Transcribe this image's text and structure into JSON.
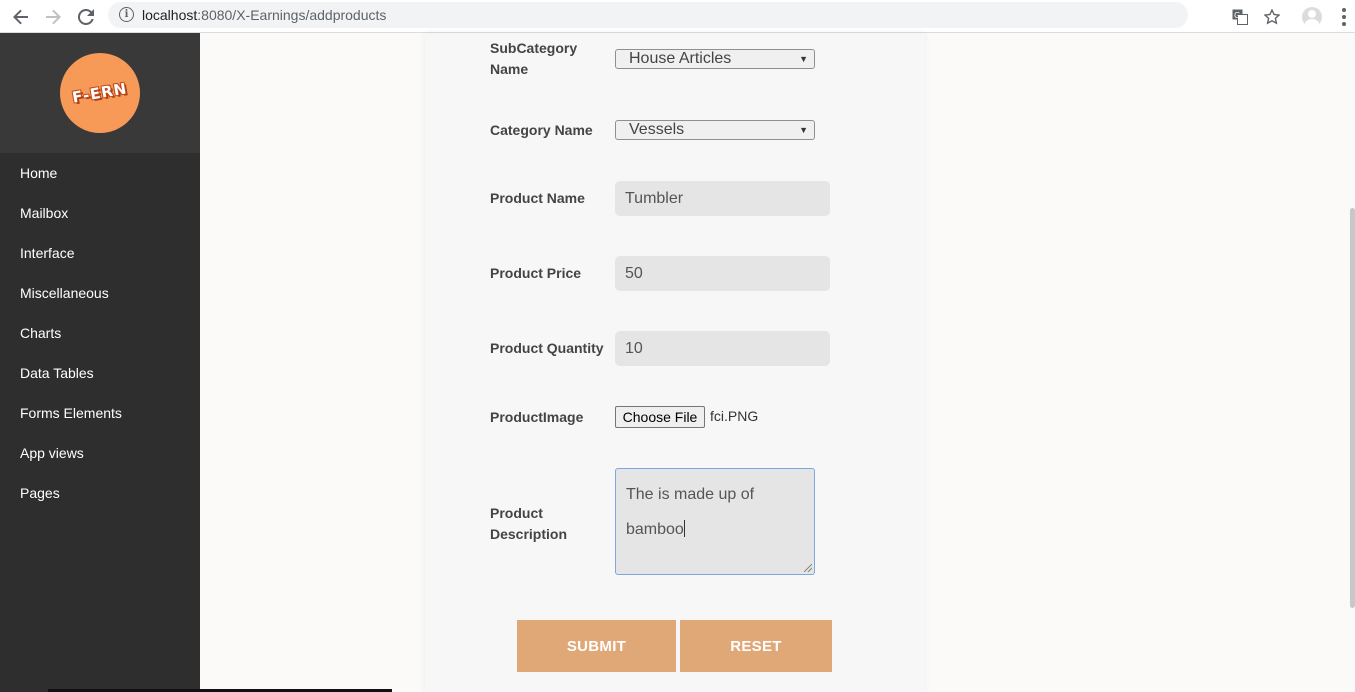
{
  "browser": {
    "url_host": "localhost",
    "url_rest": ":8080/X-Earnings/addproducts"
  },
  "sidebar": {
    "logo_text": "F-ERN",
    "items": [
      {
        "label": "Home"
      },
      {
        "label": "Mailbox"
      },
      {
        "label": "Interface"
      },
      {
        "label": "Miscellaneous"
      },
      {
        "label": "Charts"
      },
      {
        "label": "Data Tables"
      },
      {
        "label": "Forms Elements"
      },
      {
        "label": "App views"
      },
      {
        "label": "Pages"
      }
    ]
  },
  "form": {
    "subcategory_label_1": "SubCategory",
    "subcategory_label_2": "Name",
    "subcategory_value": "House Articles",
    "category_label": "Category Name",
    "category_value": "Vessels",
    "product_name_label": "Product Name",
    "product_name_value": "Tumbler",
    "product_price_label": "Product Price",
    "product_price_value": "50",
    "product_quantity_label": "Product Quantity",
    "product_quantity_value": "10",
    "product_image_label": "ProductImage",
    "choose_file_label": "Choose File",
    "file_name": "fci.PNG",
    "description_label_1": "Product",
    "description_label_2": "Description",
    "description_line_1": "The is made up of",
    "description_line_2": "bamboo",
    "submit_label": "SUBMIT",
    "reset_label": "RESET"
  },
  "colors": {
    "sidebar_bg": "#2e2e2e",
    "button_bg": "#e0a877",
    "logo_bg": "#f79a58"
  }
}
